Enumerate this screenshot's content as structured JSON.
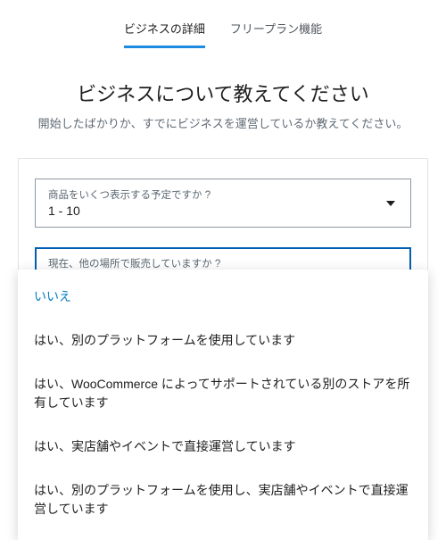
{
  "tabs": {
    "business_details": "ビジネスの詳細",
    "free_plan_features": "フリープラン機能"
  },
  "heading": {
    "title": "ビジネスについて教えてください",
    "subtitle": "開始したばかりか、すでにビジネスを運営しているか教えてください。"
  },
  "selects": {
    "product_count": {
      "label": "商品をいくつ表示する予定ですか ?",
      "value": "1 - 10"
    },
    "selling_elsewhere": {
      "label": "現在、他の場所で販売していますか ?",
      "value": "いいえ"
    }
  },
  "dropdown_options": [
    "いいえ",
    "はい、別のプラットフォームを使用しています",
    "はい、WooCommerce によってサポートされている別のストアを所有しています",
    "はい、実店舗やイベントで直接運営しています",
    "はい、別のプラットフォームを使用し、実店舗やイベントで直接運営しています"
  ],
  "colors": {
    "accent": "#1d8ce0",
    "focus_border": "#005fb3",
    "selected_option": "#067cc1"
  }
}
